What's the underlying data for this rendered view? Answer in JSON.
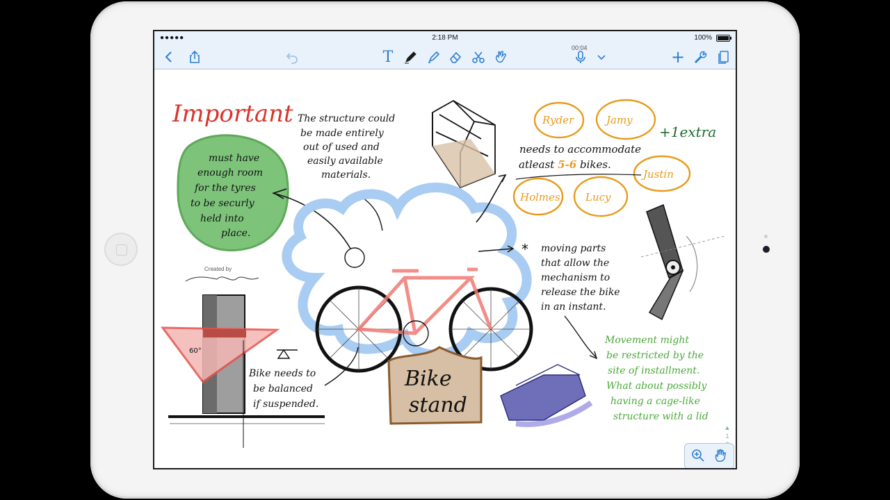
{
  "status": {
    "carrier_dots": "●●●●● ",
    "time": "2:18 PM",
    "battery": "100%"
  },
  "toolbar": {
    "timer": "00:04",
    "back_icon": "back-chevron",
    "share_icon": "share",
    "undo_icon": "undo",
    "text_tool": "T",
    "add_icon": "+"
  },
  "notes": {
    "important_title": "Important",
    "green_note": [
      "must have",
      "enough room",
      "for the tyres",
      "to be securly",
      "held into",
      "place."
    ],
    "created_by": "Created by",
    "structure_note": [
      "The structure could",
      "be made entirely",
      "out of used and",
      "easily available",
      "materials."
    ],
    "accommodate_line1": "needs to accommodate",
    "accommodate_prefix": "atleast ",
    "accommodate_count": "5-6",
    "accommodate_suffix": " bikes.",
    "names": [
      "Ryder",
      "Jamy",
      "Justin",
      "Holmes",
      "Lucy"
    ],
    "plus_extra": "+1extra",
    "moving_parts": [
      "moving parts",
      "that allow the",
      "mechanism to",
      "release the bike",
      "in an instant."
    ],
    "asterisk": "*",
    "balanced_note": [
      "Bike needs to",
      "be balanced",
      "if suspended."
    ],
    "angle": "60°",
    "sign": [
      "Bike",
      "stand"
    ],
    "movement_note": [
      "Movement might",
      "be restricted by the",
      "site of installment.",
      "What about possibly",
      "having a cage-like",
      "structure with a lid"
    ],
    "page_numbers": [
      "1",
      "2"
    ]
  },
  "colors": {
    "accent": "#2d7fd2",
    "red": "#d9342b",
    "green": "#4aa83a",
    "orange": "#e89a1a",
    "cloud": "#a9ccf2",
    "darkgreen": "#1f6b2a"
  }
}
